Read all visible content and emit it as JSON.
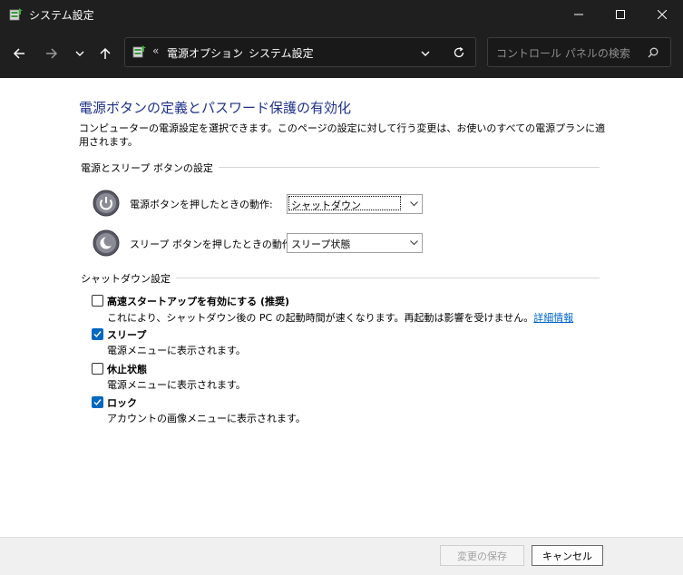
{
  "window": {
    "title": "システム設定"
  },
  "address": {
    "prefix": "«",
    "crumb1": "電源オプション",
    "separator": "›",
    "crumb2": "システム設定"
  },
  "search": {
    "placeholder": "コントロール パネルの検索"
  },
  "page": {
    "title": "電源ボタンの定義とパスワード保護の有効化",
    "description": "コンピューターの電源設定を選択できます。このページの設定に対して行う変更は、お使いのすべての電源プランに適用されます。"
  },
  "power_section": {
    "title": "電源とスリープ ボタンの設定",
    "power_button_label": "電源ボタンを押したときの動作:",
    "power_button_value": "シャットダウン",
    "sleep_button_label": "スリープ ボタンを押したときの動作:",
    "sleep_button_value": "スリープ状態"
  },
  "shutdown_section": {
    "title": "シャットダウン設定",
    "fast_startup": {
      "label": "高速スタートアップを有効にする (推奨)",
      "desc": "これにより、シャットダウン後の PC の起動時間が速くなります。再起動は影響を受けません。",
      "link": "詳細情報",
      "checked": false
    },
    "sleep": {
      "label": "スリープ",
      "desc": "電源メニューに表示されます。",
      "checked": true
    },
    "hibernate": {
      "label": "休止状態",
      "desc": "電源メニューに表示されます。",
      "checked": false
    },
    "lock": {
      "label": "ロック",
      "desc": "アカウントの画像メニューに表示されます。",
      "checked": true
    }
  },
  "footer": {
    "save_label": "変更の保存",
    "cancel_label": "キャンセル"
  },
  "colors": {
    "title_blue": "#1e3287",
    "checkbox_blue": "#0067c0",
    "chrome_dark": "#1f1f1f"
  }
}
